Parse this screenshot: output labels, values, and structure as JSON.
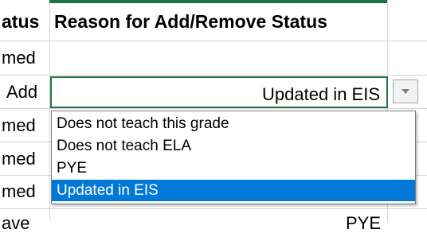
{
  "header": {
    "status_col": "atus",
    "reason_col": "Reason for Add/Remove Status"
  },
  "rows": [
    {
      "status": "med",
      "reason": ""
    },
    {
      "status": "Add",
      "reason": "Updated in EIS"
    },
    {
      "status": "med",
      "reason": ""
    },
    {
      "status": "med",
      "reason": ""
    },
    {
      "status": "med",
      "reason": ""
    },
    {
      "status": "ave",
      "reason": "PYE"
    }
  ],
  "dropdown": {
    "options": [
      "Does not teach this grade",
      "Does not teach ELA",
      "PYE",
      "Updated in EIS"
    ],
    "selected_index": 3,
    "button_icon": "chevron-down-icon"
  },
  "colors": {
    "accent_green": "#217346",
    "selection_blue": "#0078d7",
    "gridline": "#d4d4d4"
  }
}
